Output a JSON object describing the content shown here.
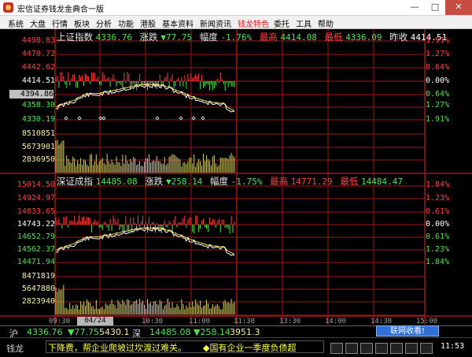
{
  "window": {
    "title": "宏信证券钱龙金典合一版",
    "min": "—",
    "max": "□",
    "close": "✕"
  },
  "menu": [
    {
      "label": "系统"
    },
    {
      "label": "大盘"
    },
    {
      "label": "行情"
    },
    {
      "label": "板块"
    },
    {
      "label": "分析"
    },
    {
      "label": "功能"
    },
    {
      "label": "港股"
    },
    {
      "label": "基本资料"
    },
    {
      "label": "新闻资讯"
    },
    {
      "label": "钱龙特色",
      "highlight": true
    },
    {
      "label": "委托"
    },
    {
      "label": "工具"
    },
    {
      "label": "帮助"
    }
  ],
  "sh": {
    "name": "上证指数",
    "value": "4336.76",
    "change_label": "涨跌",
    "change": "▼77.75",
    "amp_label": "幅度",
    "amp": "-1.76%",
    "high_label": "最高",
    "high": "4414.08",
    "low_label": "最低",
    "low": "4336.09",
    "prev_label": "昨收",
    "prev": "4414.51",
    "left_axis": [
      "4498.83",
      "4470.72",
      "4442.62",
      "4414.51",
      "4394.86",
      "4358.30",
      "4330.19"
    ],
    "right_axis": [
      "1.91%",
      "1.27%",
      "0.64%",
      "0.00%",
      "0.64%",
      "1.27%",
      "1.91%"
    ],
    "vol_axis": [
      "8510851",
      "5673901",
      "2836950"
    ]
  },
  "sz": {
    "name": "深证成指",
    "value": "14485.08",
    "change_label": "涨跌",
    "change": "▼258.14",
    "amp_label": "幅度",
    "amp": "-1.75%",
    "high_label": "最高",
    "high": "14771.29",
    "low_label": "最低",
    "low": "14484.47",
    "left_axis": [
      "15014.50",
      "14924.97",
      "14833.65",
      "14743.22",
      "14652.79",
      "14562.37",
      "14471.94"
    ],
    "right_axis": [
      "1.84%",
      "1.23%",
      "0.61%",
      "0.00%",
      "0.61%",
      "1.23%",
      "1.84%"
    ],
    "vol_axis": [
      "8471819",
      "5647880",
      "2823940"
    ]
  },
  "time_axis": [
    "09:30",
    "10:30",
    "11:00",
    "11:30",
    "13:30",
    "14:00",
    "14:30",
    "15:00"
  ],
  "time_cursor": "04/24 09:42",
  "status": {
    "sh_label": "沪",
    "sh_value": "4336.76",
    "sh_change": "▼77.75",
    "sh_amount": "5430.1",
    "sz_label": "深",
    "sz_value": "14485.08",
    "sz_change": "▼258.14",
    "sz_amount": "3951.3",
    "connect": "联网收看!"
  },
  "ticker": {
    "brand": "钱龙",
    "news1": "下降费，帮企业爬坡过坎渡过难关。",
    "news2": "◆国有企业一季度负债超",
    "clock": "11:53"
  },
  "colors": {
    "up": "#ff4040",
    "down": "#52e052",
    "grid": "#a01818",
    "price": "#ffffff",
    "avg": "#f0e060",
    "volume": "#d8d070"
  }
}
